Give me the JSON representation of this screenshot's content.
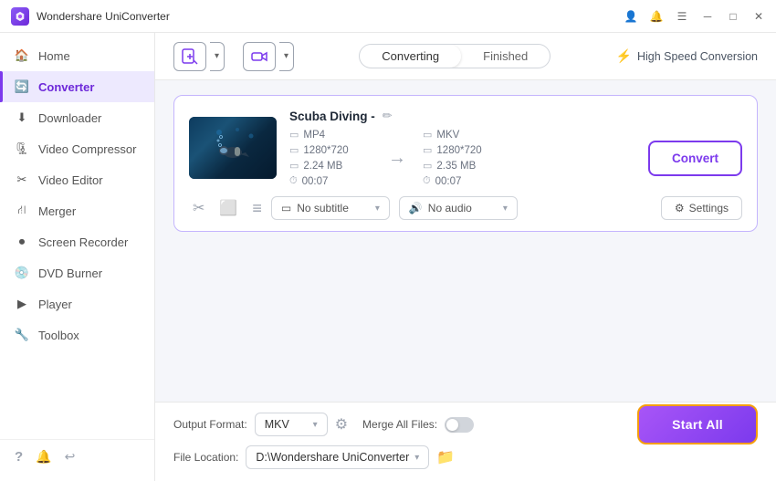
{
  "titleBar": {
    "appName": "Wondershare UniConverter"
  },
  "sidebar": {
    "items": [
      {
        "id": "home",
        "label": "Home",
        "icon": "home"
      },
      {
        "id": "converter",
        "label": "Converter",
        "icon": "converter",
        "active": true
      },
      {
        "id": "downloader",
        "label": "Downloader",
        "icon": "download"
      },
      {
        "id": "video-compressor",
        "label": "Video Compressor",
        "icon": "compress"
      },
      {
        "id": "video-editor",
        "label": "Video Editor",
        "icon": "edit"
      },
      {
        "id": "merger",
        "label": "Merger",
        "icon": "merge"
      },
      {
        "id": "screen-recorder",
        "label": "Screen Recorder",
        "icon": "record"
      },
      {
        "id": "dvd-burner",
        "label": "DVD Burner",
        "icon": "dvd"
      },
      {
        "id": "player",
        "label": "Player",
        "icon": "play"
      },
      {
        "id": "toolbox",
        "label": "Toolbox",
        "icon": "toolbox"
      }
    ],
    "footer": {
      "help": "?",
      "bell": "🔔",
      "feedback": "💬"
    }
  },
  "topBar": {
    "addFileLabel": "+",
    "addCamLabel": "🎥",
    "tabs": {
      "converting": "Converting",
      "finished": "Finished",
      "activeTab": "converting"
    },
    "highSpeedConversion": "High Speed Conversion"
  },
  "fileCard": {
    "title": "Scuba Diving -",
    "inputFormat": "MP4",
    "inputResolution": "1280*720",
    "inputSize": "2.24 MB",
    "inputDuration": "00:07",
    "outputFormat": "MKV",
    "outputResolution": "1280*720",
    "outputSize": "2.35 MB",
    "outputDuration": "00:07",
    "convertBtnLabel": "Convert",
    "subtitleLabel": "No subtitle",
    "audioLabel": "No audio",
    "settingsLabel": "Settings",
    "actions": {
      "cut": "✂",
      "crop": "⬜",
      "effects": "≡"
    }
  },
  "bottomBar": {
    "outputFormatLabel": "Output Format:",
    "outputFormatValue": "MKV",
    "fileLocationLabel": "File Location:",
    "fileLocationValue": "D:\\Wondershare UniConverter",
    "mergeAllFilesLabel": "Merge All Files:",
    "startAllLabel": "Start All"
  }
}
